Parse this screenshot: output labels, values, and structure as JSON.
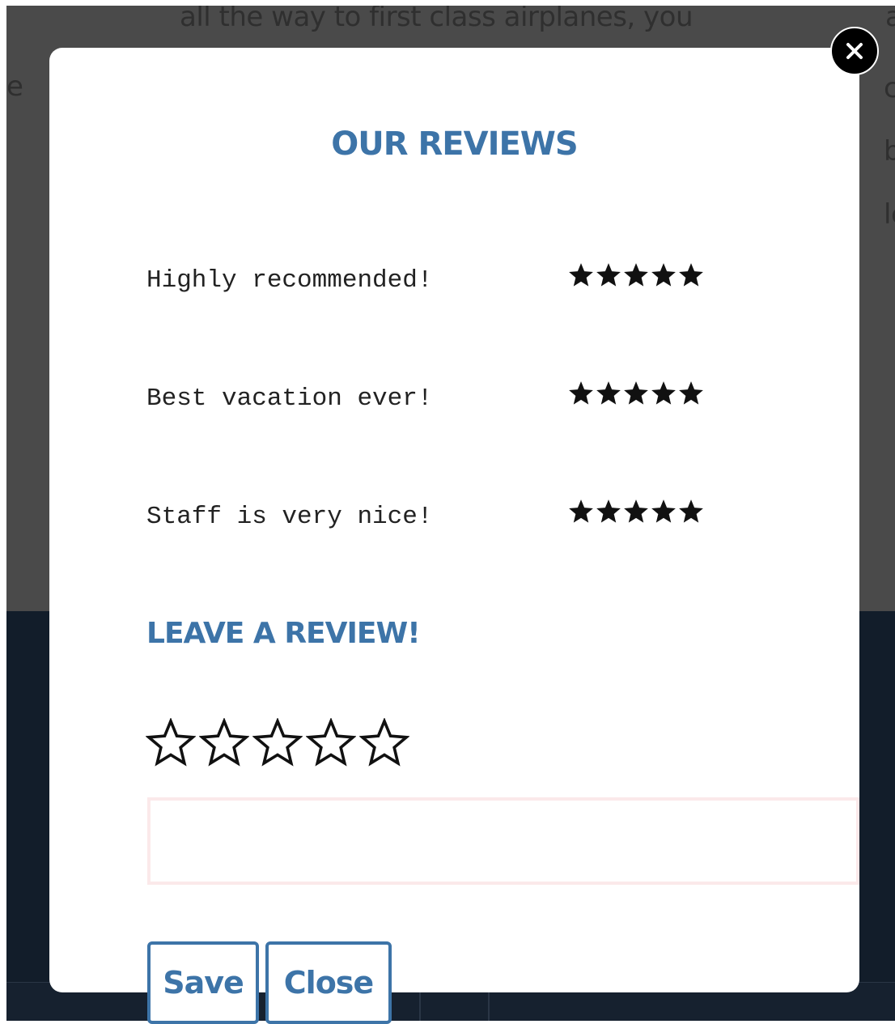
{
  "background": {
    "text_line": "all the way to first class airplanes, you",
    "left_fragment": "e",
    "right_fragments": [
      "a",
      "c",
      "b",
      "le"
    ]
  },
  "modal": {
    "title": "OUR REVIEWS",
    "reviews": [
      {
        "text": "Highly recommended!",
        "rating": 5
      },
      {
        "text": "Best vacation ever!",
        "rating": 5
      },
      {
        "text": "Staff is very nice!",
        "rating": 5
      }
    ],
    "leave_review": {
      "title": "LEAVE A REVIEW!",
      "rating_value": 0,
      "rating_max": 5,
      "input_value": "",
      "input_placeholder": ""
    },
    "buttons": {
      "save_label": "Save",
      "close_label": "Close"
    },
    "close_icon": "close-x-icon"
  },
  "colors": {
    "accent": "#3d74a8",
    "input_border": "#fbe9ea",
    "overlay": "#4a4a4a",
    "footer": "#121d2a"
  }
}
